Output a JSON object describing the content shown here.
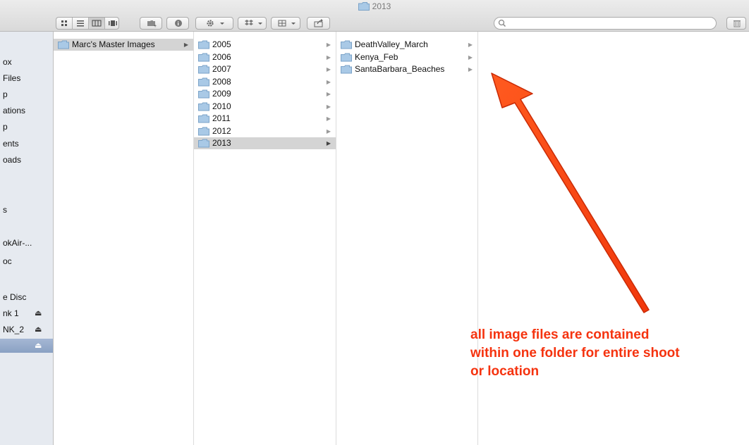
{
  "window": {
    "title": "2013"
  },
  "toolbar": {
    "search_placeholder": "",
    "icons": [
      "icon-view",
      "list-view",
      "column-view",
      "coverflow-view",
      "new-folder",
      "info",
      "action",
      "dropbox",
      "arrange",
      "share",
      "trash"
    ]
  },
  "sidebar": {
    "items": [
      {
        "label": "ox"
      },
      {
        "label": "Files"
      },
      {
        "label": "p"
      },
      {
        "label": "ations"
      },
      {
        "label": "p"
      },
      {
        "label": "ents"
      },
      {
        "label": "oads"
      },
      {
        "label": "s"
      },
      {
        "label": "okAir-..."
      },
      {
        "label": "oc"
      },
      {
        "label": "e Disc"
      },
      {
        "label": "nk 1",
        "eject": "⏏"
      },
      {
        "label": "NK_2",
        "eject": "⏏"
      },
      {
        "label": "",
        "eject": "⏏",
        "selected": true
      }
    ]
  },
  "columns": {
    "col1": [
      {
        "name": "Marc's Master Images",
        "selected": true
      }
    ],
    "col2": [
      {
        "name": "2005"
      },
      {
        "name": "2006"
      },
      {
        "name": "2007"
      },
      {
        "name": "2008"
      },
      {
        "name": "2009"
      },
      {
        "name": "2010"
      },
      {
        "name": "2011"
      },
      {
        "name": "2012"
      },
      {
        "name": "2013",
        "selected": true
      }
    ],
    "col3": [
      {
        "name": "DeathValley_March"
      },
      {
        "name": "Kenya_Feb"
      },
      {
        "name": "SantaBarbara_Beaches"
      }
    ]
  },
  "annotation": {
    "line1": "all image files are contained",
    "line2": "within one folder for entire shoot",
    "line3": "or location",
    "color": "#f5330f"
  }
}
